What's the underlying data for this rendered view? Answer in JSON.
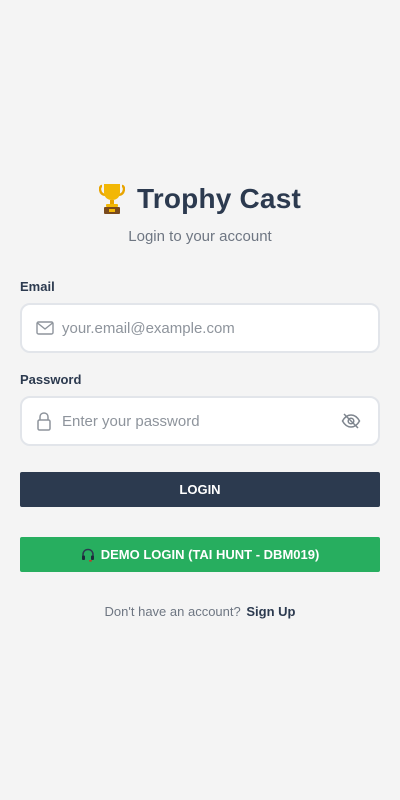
{
  "app": {
    "title": "Trophy Cast",
    "subtitle": "Login to your account",
    "logo_icon": "trophy-icon"
  },
  "form": {
    "email": {
      "label": "Email",
      "placeholder": "your.email@example.com",
      "value": "",
      "icon": "mail-icon"
    },
    "password": {
      "label": "Password",
      "placeholder": "Enter your password",
      "value": "",
      "icon": "lock-icon",
      "toggle_icon": "eye-off-icon"
    },
    "login_button": "LOGIN",
    "demo_button": "DEMO LOGIN (TAI HUNT - DBM019)",
    "demo_icon": "headset-icon"
  },
  "footer": {
    "prompt": "Don't have an account?",
    "signup_link": "Sign Up"
  },
  "colors": {
    "background": "#f4f4f4",
    "primary": "#2c3a4f",
    "success": "#27ae5f",
    "muted_text": "#6e7682",
    "input_border": "#e2e5ea"
  }
}
